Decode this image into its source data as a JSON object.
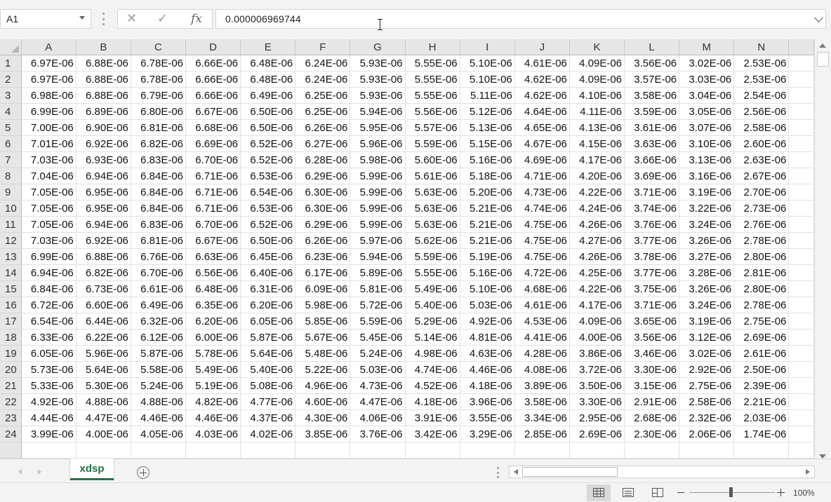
{
  "formula_bar": {
    "name_box": "A1",
    "cancel_icon": "close-icon",
    "enter_icon": "checkmark-icon",
    "function_label": "fx",
    "formula_value": "0.000006969744"
  },
  "grid": {
    "columns": [
      "A",
      "B",
      "C",
      "D",
      "E",
      "F",
      "G",
      "H",
      "I",
      "J",
      "K",
      "L",
      "M",
      "N"
    ],
    "rows": [
      {
        "n": "1",
        "cells": [
          "6.97E-06",
          "6.88E-06",
          "6.78E-06",
          "6.66E-06",
          "6.48E-06",
          "6.24E-06",
          "5.93E-06",
          "5.55E-06",
          "5.10E-06",
          "4.61E-06",
          "4.09E-06",
          "3.56E-06",
          "3.02E-06",
          "2.53E-06"
        ]
      },
      {
        "n": "2",
        "cells": [
          "6.97E-06",
          "6.88E-06",
          "6.78E-06",
          "6.66E-06",
          "6.48E-06",
          "6.24E-06",
          "5.93E-06",
          "5.55E-06",
          "5.10E-06",
          "4.62E-06",
          "4.09E-06",
          "3.57E-06",
          "3.03E-06",
          "2.53E-06"
        ]
      },
      {
        "n": "3",
        "cells": [
          "6.98E-06",
          "6.88E-06",
          "6.79E-06",
          "6.66E-06",
          "6.49E-06",
          "6.25E-06",
          "5.93E-06",
          "5.55E-06",
          "5.11E-06",
          "4.62E-06",
          "4.10E-06",
          "3.58E-06",
          "3.04E-06",
          "2.54E-06"
        ]
      },
      {
        "n": "4",
        "cells": [
          "6.99E-06",
          "6.89E-06",
          "6.80E-06",
          "6.67E-06",
          "6.50E-06",
          "6.25E-06",
          "5.94E-06",
          "5.56E-06",
          "5.12E-06",
          "4.64E-06",
          "4.11E-06",
          "3.59E-06",
          "3.05E-06",
          "2.56E-06"
        ]
      },
      {
        "n": "5",
        "cells": [
          "7.00E-06",
          "6.90E-06",
          "6.81E-06",
          "6.68E-06",
          "6.50E-06",
          "6.26E-06",
          "5.95E-06",
          "5.57E-06",
          "5.13E-06",
          "4.65E-06",
          "4.13E-06",
          "3.61E-06",
          "3.07E-06",
          "2.58E-06"
        ]
      },
      {
        "n": "6",
        "cells": [
          "7.01E-06",
          "6.92E-06",
          "6.82E-06",
          "6.69E-06",
          "6.52E-06",
          "6.27E-06",
          "5.96E-06",
          "5.59E-06",
          "5.15E-06",
          "4.67E-06",
          "4.15E-06",
          "3.63E-06",
          "3.10E-06",
          "2.60E-06"
        ]
      },
      {
        "n": "7",
        "cells": [
          "7.03E-06",
          "6.93E-06",
          "6.83E-06",
          "6.70E-06",
          "6.52E-06",
          "6.28E-06",
          "5.98E-06",
          "5.60E-06",
          "5.16E-06",
          "4.69E-06",
          "4.17E-06",
          "3.66E-06",
          "3.13E-06",
          "2.63E-06"
        ]
      },
      {
        "n": "8",
        "cells": [
          "7.04E-06",
          "6.94E-06",
          "6.84E-06",
          "6.71E-06",
          "6.53E-06",
          "6.29E-06",
          "5.99E-06",
          "5.61E-06",
          "5.18E-06",
          "4.71E-06",
          "4.20E-06",
          "3.69E-06",
          "3.16E-06",
          "2.67E-06"
        ]
      },
      {
        "n": "9",
        "cells": [
          "7.05E-06",
          "6.95E-06",
          "6.84E-06",
          "6.71E-06",
          "6.54E-06",
          "6.30E-06",
          "5.99E-06",
          "5.63E-06",
          "5.20E-06",
          "4.73E-06",
          "4.22E-06",
          "3.71E-06",
          "3.19E-06",
          "2.70E-06"
        ]
      },
      {
        "n": "10",
        "cells": [
          "7.05E-06",
          "6.95E-06",
          "6.84E-06",
          "6.71E-06",
          "6.53E-06",
          "6.30E-06",
          "5.99E-06",
          "5.63E-06",
          "5.21E-06",
          "4.74E-06",
          "4.24E-06",
          "3.74E-06",
          "3.22E-06",
          "2.73E-06"
        ]
      },
      {
        "n": "11",
        "cells": [
          "7.05E-06",
          "6.94E-06",
          "6.83E-06",
          "6.70E-06",
          "6.52E-06",
          "6.29E-06",
          "5.99E-06",
          "5.63E-06",
          "5.21E-06",
          "4.75E-06",
          "4.26E-06",
          "3.76E-06",
          "3.24E-06",
          "2.76E-06"
        ]
      },
      {
        "n": "12",
        "cells": [
          "7.03E-06",
          "6.92E-06",
          "6.81E-06",
          "6.67E-06",
          "6.50E-06",
          "6.26E-06",
          "5.97E-06",
          "5.62E-06",
          "5.21E-06",
          "4.75E-06",
          "4.27E-06",
          "3.77E-06",
          "3.26E-06",
          "2.78E-06"
        ]
      },
      {
        "n": "13",
        "cells": [
          "6.99E-06",
          "6.88E-06",
          "6.76E-06",
          "6.63E-06",
          "6.45E-06",
          "6.23E-06",
          "5.94E-06",
          "5.59E-06",
          "5.19E-06",
          "4.75E-06",
          "4.26E-06",
          "3.78E-06",
          "3.27E-06",
          "2.80E-06"
        ]
      },
      {
        "n": "14",
        "cells": [
          "6.94E-06",
          "6.82E-06",
          "6.70E-06",
          "6.56E-06",
          "6.40E-06",
          "6.17E-06",
          "5.89E-06",
          "5.55E-06",
          "5.16E-06",
          "4.72E-06",
          "4.25E-06",
          "3.77E-06",
          "3.28E-06",
          "2.81E-06"
        ]
      },
      {
        "n": "15",
        "cells": [
          "6.84E-06",
          "6.73E-06",
          "6.61E-06",
          "6.48E-06",
          "6.31E-06",
          "6.09E-06",
          "5.81E-06",
          "5.49E-06",
          "5.10E-06",
          "4.68E-06",
          "4.22E-06",
          "3.75E-06",
          "3.26E-06",
          "2.80E-06"
        ]
      },
      {
        "n": "16",
        "cells": [
          "6.72E-06",
          "6.60E-06",
          "6.49E-06",
          "6.35E-06",
          "6.20E-06",
          "5.98E-06",
          "5.72E-06",
          "5.40E-06",
          "5.03E-06",
          "4.61E-06",
          "4.17E-06",
          "3.71E-06",
          "3.24E-06",
          "2.78E-06"
        ]
      },
      {
        "n": "17",
        "cells": [
          "6.54E-06",
          "6.44E-06",
          "6.32E-06",
          "6.20E-06",
          "6.05E-06",
          "5.85E-06",
          "5.59E-06",
          "5.29E-06",
          "4.92E-06",
          "4.53E-06",
          "4.09E-06",
          "3.65E-06",
          "3.19E-06",
          "2.75E-06"
        ]
      },
      {
        "n": "18",
        "cells": [
          "6.33E-06",
          "6.22E-06",
          "6.12E-06",
          "6.00E-06",
          "5.87E-06",
          "5.67E-06",
          "5.45E-06",
          "5.14E-06",
          "4.81E-06",
          "4.41E-06",
          "4.00E-06",
          "3.56E-06",
          "3.12E-06",
          "2.69E-06"
        ]
      },
      {
        "n": "19",
        "cells": [
          "6.05E-06",
          "5.96E-06",
          "5.87E-06",
          "5.78E-06",
          "5.64E-06",
          "5.48E-06",
          "5.24E-06",
          "4.98E-06",
          "4.63E-06",
          "4.28E-06",
          "3.86E-06",
          "3.46E-06",
          "3.02E-06",
          "2.61E-06"
        ]
      },
      {
        "n": "20",
        "cells": [
          "5.73E-06",
          "5.64E-06",
          "5.58E-06",
          "5.49E-06",
          "5.40E-06",
          "5.22E-06",
          "5.03E-06",
          "4.74E-06",
          "4.46E-06",
          "4.08E-06",
          "3.72E-06",
          "3.30E-06",
          "2.92E-06",
          "2.50E-06"
        ]
      },
      {
        "n": "21",
        "cells": [
          "5.33E-06",
          "5.30E-06",
          "5.24E-06",
          "5.19E-06",
          "5.08E-06",
          "4.96E-06",
          "4.73E-06",
          "4.52E-06",
          "4.18E-06",
          "3.89E-06",
          "3.50E-06",
          "3.15E-06",
          "2.75E-06",
          "2.39E-06"
        ]
      },
      {
        "n": "22",
        "cells": [
          "4.92E-06",
          "4.88E-06",
          "4.88E-06",
          "4.82E-06",
          "4.77E-06",
          "4.60E-06",
          "4.47E-06",
          "4.18E-06",
          "3.96E-06",
          "3.58E-06",
          "3.30E-06",
          "2.91E-06",
          "2.58E-06",
          "2.21E-06"
        ]
      },
      {
        "n": "23",
        "cells": [
          "4.44E-06",
          "4.47E-06",
          "4.46E-06",
          "4.46E-06",
          "4.37E-06",
          "4.30E-06",
          "4.06E-06",
          "3.91E-06",
          "3.55E-06",
          "3.34E-06",
          "2.95E-06",
          "2.68E-06",
          "2.32E-06",
          "2.03E-06"
        ]
      },
      {
        "n": "24",
        "cells": [
          "3.99E-06",
          "4.00E-06",
          "4.05E-06",
          "4.03E-06",
          "4.02E-06",
          "3.85E-06",
          "3.76E-06",
          "3.42E-06",
          "3.29E-06",
          "2.85E-06",
          "2.69E-06",
          "2.30E-06",
          "2.06E-06",
          "1.74E-06"
        ]
      }
    ]
  },
  "sheet_tabs": {
    "active_tab": "xdsp",
    "add_sheet_icon": "plus-circle-icon"
  },
  "status_bar": {
    "view_buttons": [
      "normal-view-icon",
      "page-layout-icon",
      "page-break-preview-icon"
    ],
    "zoom_label": "100%",
    "zoom_percent": 100
  },
  "colors": {
    "accent": "#217346",
    "header_bg": "#e6e6e6",
    "chrome_bg": "#f3f3f3"
  }
}
